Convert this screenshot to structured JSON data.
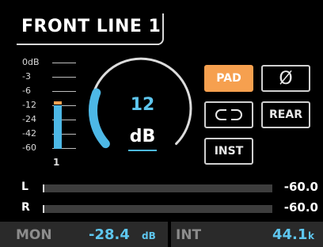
{
  "header": {
    "title": "FRONT LINE 1"
  },
  "input_meter": {
    "scale": [
      "0dB",
      "-3",
      "-6",
      "-12",
      "-24",
      "-42",
      "-60"
    ],
    "channel": "1",
    "level_color": "#4db8e6",
    "peak_color": "#f5a050"
  },
  "gain": {
    "value": "12",
    "unit": "dB",
    "arc_fraction": 0.23,
    "accent": "#4db8e6"
  },
  "buttons": {
    "pad": {
      "label": "PAD",
      "active": true
    },
    "phase": {
      "label": "Ø",
      "icon": "phase-invert-icon"
    },
    "link": {
      "icon": "stereo-link-icon"
    },
    "rear": {
      "label": "REAR"
    },
    "inst": {
      "label": "INST"
    }
  },
  "output_meters": [
    {
      "label": "L",
      "value": "-60.0"
    },
    {
      "label": "R",
      "value": "-60.0"
    }
  ],
  "footer": {
    "mon_label": "MON",
    "mon_value": "-28.4",
    "mon_unit": "dB",
    "int_label": "INT",
    "sample_rate": "44.1",
    "sample_rate_unit": "k"
  },
  "colors": {
    "accent": "#4db8e6",
    "active": "#f6a04f",
    "background": "#000000"
  }
}
